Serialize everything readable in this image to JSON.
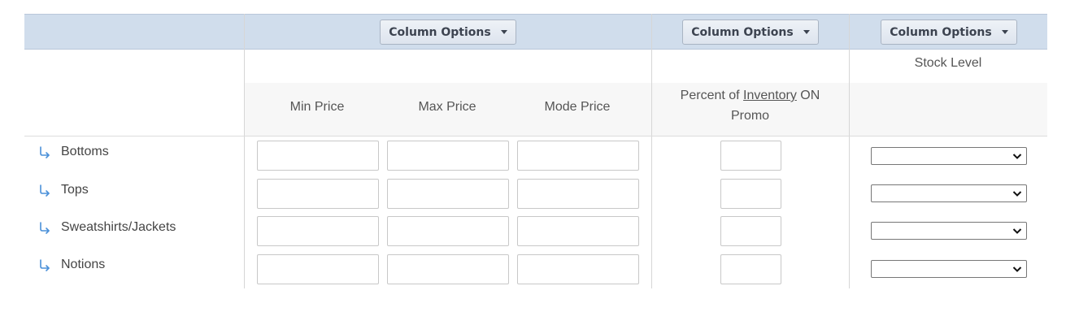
{
  "header": {
    "column_options": [
      "Column Options",
      "Column Options",
      "Column Options"
    ]
  },
  "column_groups": {
    "stock_level_title": "Stock Level"
  },
  "columns": {
    "min_price": "Min Price",
    "max_price": "Max Price",
    "mode_price": "Mode Price",
    "percent_prefix": "Percent of ",
    "percent_link": "Inventory",
    "percent_suffix_1": " ON",
    "percent_suffix_2": "Promo"
  },
  "rows": [
    {
      "label": "Bottoms",
      "min_price": "",
      "max_price": "",
      "mode_price": "",
      "percent": "",
      "stock_level": ""
    },
    {
      "label": "Tops",
      "min_price": "",
      "max_price": "",
      "mode_price": "",
      "percent": "",
      "stock_level": ""
    },
    {
      "label": "Sweatshirts/Jackets",
      "min_price": "",
      "max_price": "",
      "mode_price": "",
      "percent": "",
      "stock_level": ""
    },
    {
      "label": "Notions",
      "min_price": "",
      "max_price": "",
      "mode_price": "",
      "percent": "",
      "stock_level": ""
    }
  ],
  "colors": {
    "header_band": "#d0ddec",
    "row_icon": "#4a90d9"
  },
  "icons": {
    "row_icon": "subitem-arrow-icon",
    "dropdown": "chevron-down-icon"
  }
}
